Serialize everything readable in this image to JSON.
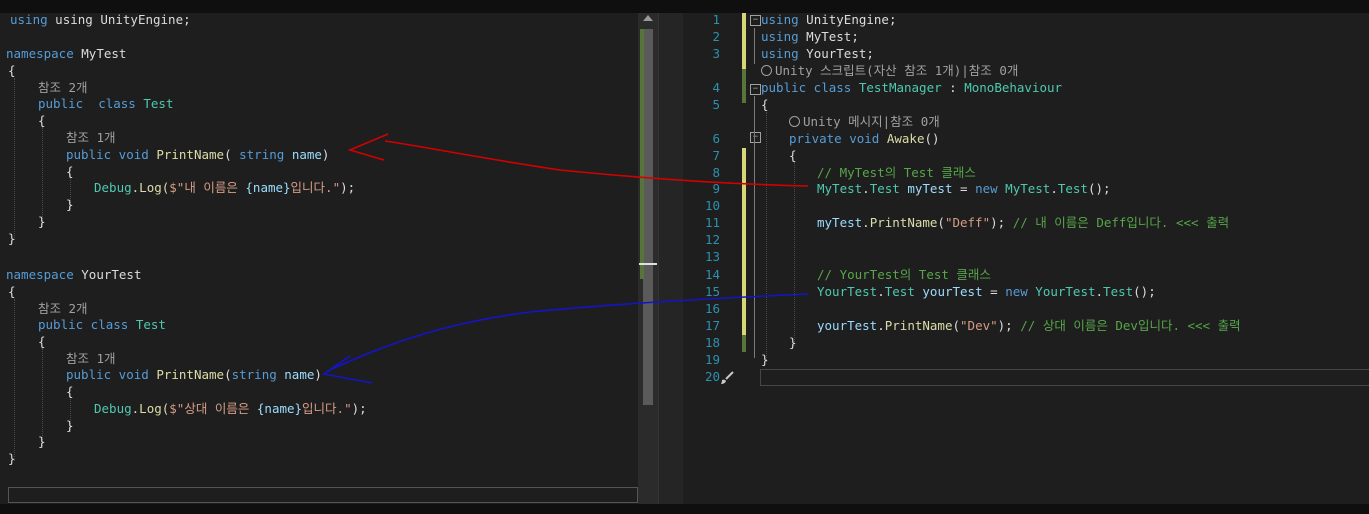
{
  "left": {
    "line1": "using UnityEngine;",
    "ns1": {
      "kw": "namespace",
      "name": "MyTest",
      "refs": "참조 2개",
      "cls_kw": "public  class",
      "cls": "Test",
      "m_refs": "참조 1개",
      "m_sig_kw": "public void",
      "m_name": "PrintName",
      "m_paren": "( ",
      "m_type": "string",
      "m_param": "name",
      "m_close": ")",
      "body_obj": "Debug",
      "body_fn": ".Log(",
      "body_s1": "$\"내 이름은 ",
      "body_var": "{name}",
      "body_s2": "입니다.\"",
      "body_end": ");"
    },
    "ns2": {
      "kw": "namespace",
      "name": "YourTest",
      "refs": "참조 2개",
      "cls_kw": "public class",
      "cls": "Test",
      "m_refs": "참조 1개",
      "m_sig_kw": "public void",
      "m_name": "PrintName",
      "m_paren": "(",
      "m_type": "string",
      "m_param": "name",
      "m_close": ")",
      "body_obj": "Debug",
      "body_fn": ".Log(",
      "body_s1": "$\"상대 이름은 ",
      "body_var": "{name}",
      "body_s2": "입니다.\"",
      "body_end": ");"
    }
  },
  "right": {
    "line_numbers": [
      "1",
      "2",
      "3",
      "4",
      "5",
      "6",
      "7",
      "8",
      "9",
      "10",
      "11",
      "12",
      "13",
      "14",
      "15",
      "16",
      "17",
      "18",
      "19",
      "20"
    ],
    "u1": "UnityEngine;",
    "u2": "MyTest;",
    "u3": "YourTest;",
    "class_meta": "Unity 스크립트(자산 참조 1개)|참조 0개",
    "class_kw": "public class",
    "class_name": "TestManager",
    "colon": " : ",
    "base": "MonoBehaviour",
    "awake_meta": "Unity 메시지|참조 0개",
    "awake_kw": "private void",
    "awake_name": "Awake",
    "awake_paren": "()",
    "c1": "// MyTest의 Test 클래스",
    "l9_ns": "MyTest",
    "l9_t": "Test",
    "l9_var": "myTest",
    "l9_new": "new",
    "l9_ns2": "MyTest",
    "l9_t2": "Test",
    "l9_end": "();",
    "l11_var": "myTest",
    "l11_fn": "PrintName",
    "l11_s": "\"Deff\"",
    "l11_end": ");",
    "l11_cm": "// 내 이름은 Deff입니다. <<< 출력",
    "c2": "// YourTest의 Test 클래스",
    "l15_ns": "YourTest",
    "l15_t": "Test",
    "l15_var": "yourTest",
    "l15_new": "new",
    "l15_ns2": "YourTest",
    "l15_t2": "Test",
    "l15_end": "();",
    "l17_var": "yourTest",
    "l17_fn": "PrintName",
    "l17_s": "\"Dev\"",
    "l17_end": ");",
    "l17_cm": "// 상대 이름은 Dev입니다. <<< 출력"
  },
  "colors": {
    "red_arrow": "#d40000",
    "blue_arrow": "#1414c8",
    "keyword": "#569cd6",
    "type": "#4ec9b0",
    "method": "#dcdcaa",
    "string": "#d69d85",
    "comment": "#57a64a"
  },
  "icons": [
    "unity-icon",
    "paintbrush-icon",
    "fold-icon"
  ]
}
